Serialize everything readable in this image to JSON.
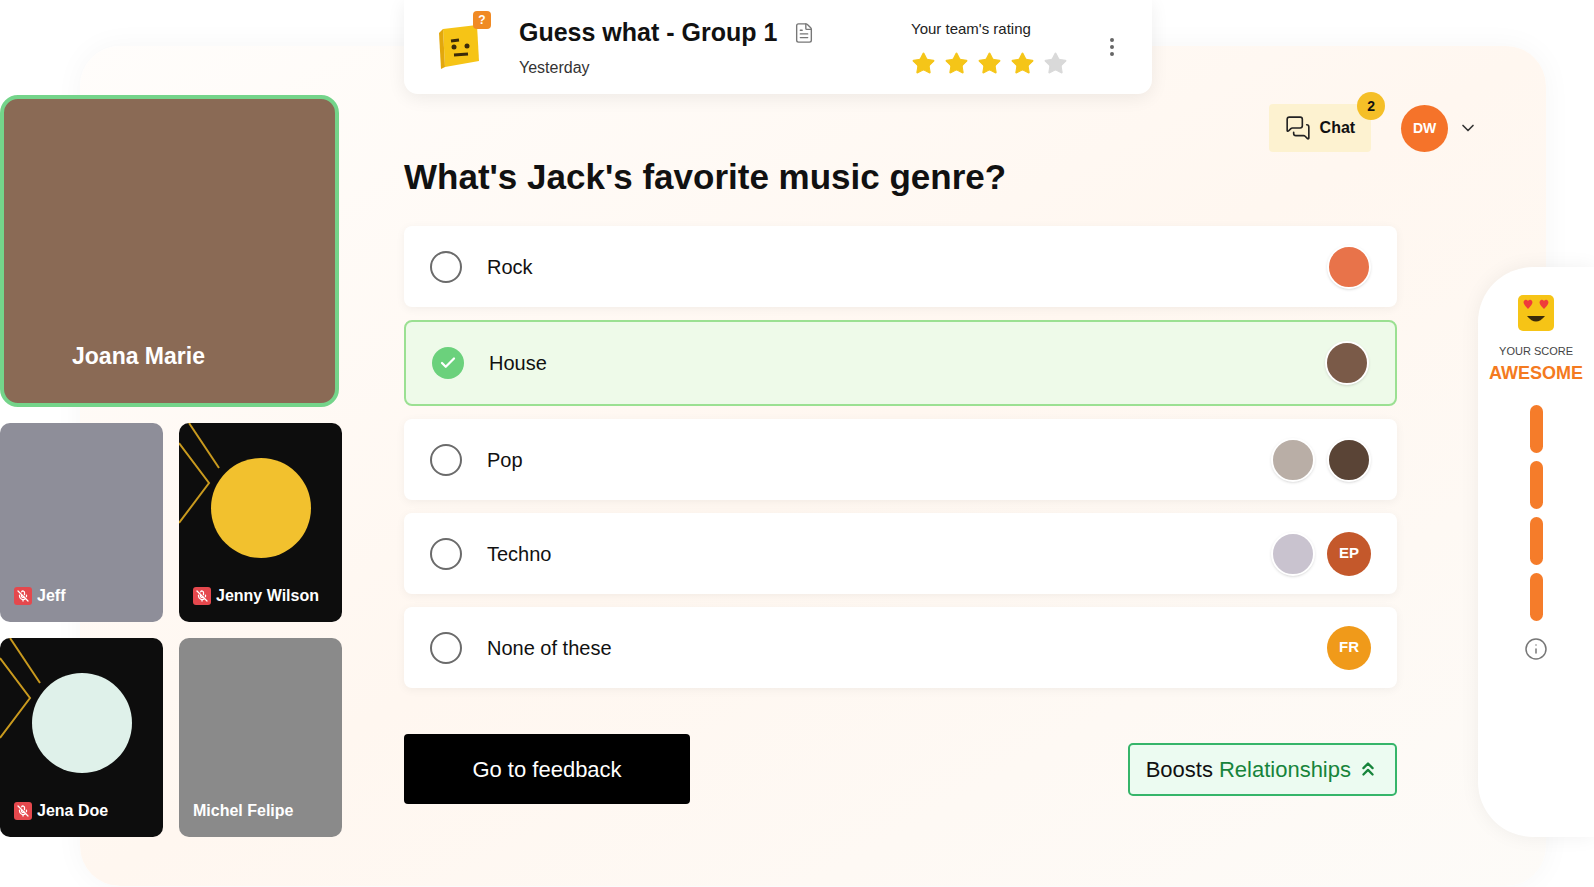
{
  "header": {
    "title": "Guess what - Group 1",
    "subtitle": "Yesterday",
    "rating_label": "Your team's rating",
    "stars": 4,
    "max_stars": 5
  },
  "logo": {
    "badge": "?"
  },
  "participants": [
    {
      "name": "Joana Marie",
      "kind": "photo",
      "muted": false,
      "speaking": true,
      "color": "#8a6a55"
    },
    {
      "name": "Jeff",
      "kind": "photo",
      "muted": true,
      "speaking": false,
      "color": "#8e8e99"
    },
    {
      "name": "Jenny Wilson",
      "kind": "avatar",
      "muted": true,
      "speaking": false,
      "color": "#f2c12e"
    },
    {
      "name": "Jena Doe",
      "kind": "avatar",
      "muted": true,
      "speaking": false,
      "color": "#dff1ea"
    },
    {
      "name": "Michel Felipe",
      "kind": "photo",
      "muted": false,
      "speaking": false,
      "color": "#8a8a8a"
    }
  ],
  "chat": {
    "label": "Chat",
    "badge": "2"
  },
  "user": {
    "initials": "DW"
  },
  "question": "What's Jack's favorite music genre?",
  "options": [
    {
      "label": "Rock",
      "selected": false,
      "voters": [
        {
          "kind": "photo",
          "color": "#e8734a"
        }
      ]
    },
    {
      "label": "House",
      "selected": true,
      "voters": [
        {
          "kind": "photo",
          "color": "#7a5a48"
        }
      ]
    },
    {
      "label": "Pop",
      "selected": false,
      "voters": [
        {
          "kind": "photo",
          "color": "#b9aea6"
        },
        {
          "kind": "photo",
          "color": "#5a4436"
        }
      ]
    },
    {
      "label": "Techno",
      "selected": false,
      "voters": [
        {
          "kind": "photo",
          "color": "#c9c3cf"
        },
        {
          "kind": "initials",
          "initials": "EP",
          "color": "#c4582b"
        }
      ]
    },
    {
      "label": "None of these",
      "selected": false,
      "voters": [
        {
          "kind": "initials",
          "initials": "FR",
          "color": "#f09a1a"
        }
      ]
    }
  ],
  "feedback_button": "Go to feedback",
  "boost": {
    "prefix": "Boosts",
    "highlight": "Relationships"
  },
  "score": {
    "label": "YOUR SCORE",
    "value": "AWESOME",
    "bars": 4
  }
}
